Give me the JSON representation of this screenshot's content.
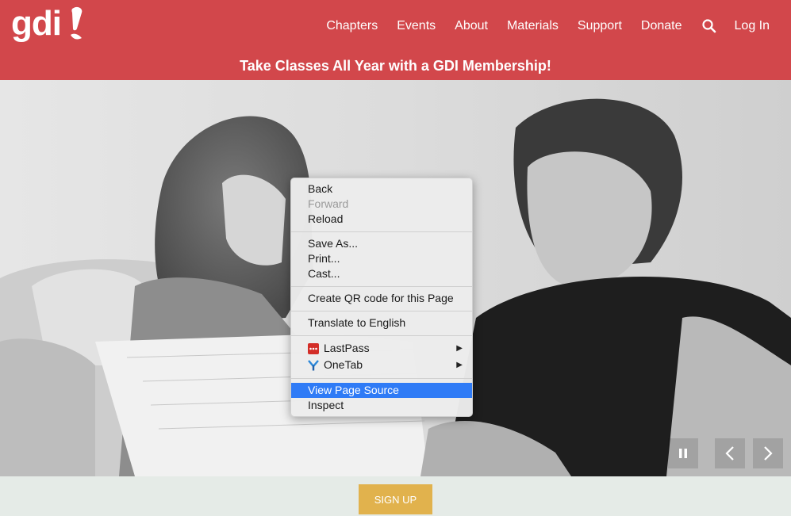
{
  "header": {
    "logo_text": "gdi",
    "nav": [
      "Chapters",
      "Events",
      "About",
      "Materials",
      "Support",
      "Donate"
    ],
    "login_label": "Log In",
    "banner_text": "Take Classes All Year with a GDI Membership!",
    "colors": {
      "header_bg": "#d2474b",
      "signup_bg": "#e1b24d"
    }
  },
  "hero": {
    "controls": {
      "pause_icon": "pause-icon",
      "prev_icon": "chevron-left-icon",
      "next_icon": "chevron-right-icon"
    }
  },
  "signup": {
    "label": "SIGN UP"
  },
  "context_menu": {
    "groups": [
      [
        {
          "label": "Back"
        },
        {
          "label": "Forward",
          "disabled": true
        },
        {
          "label": "Reload"
        }
      ],
      [
        {
          "label": "Save As..."
        },
        {
          "label": "Print..."
        },
        {
          "label": "Cast..."
        }
      ],
      [
        {
          "label": "Create QR code for this Page"
        }
      ],
      [
        {
          "label": "Translate to English"
        }
      ],
      [
        {
          "label": "LastPass",
          "icon": "lastpass-icon",
          "submenu": true
        },
        {
          "label": "OneTab",
          "icon": "onetab-icon",
          "submenu": true
        }
      ],
      [
        {
          "label": "View Page Source",
          "highlighted": true
        },
        {
          "label": "Inspect"
        }
      ]
    ]
  }
}
